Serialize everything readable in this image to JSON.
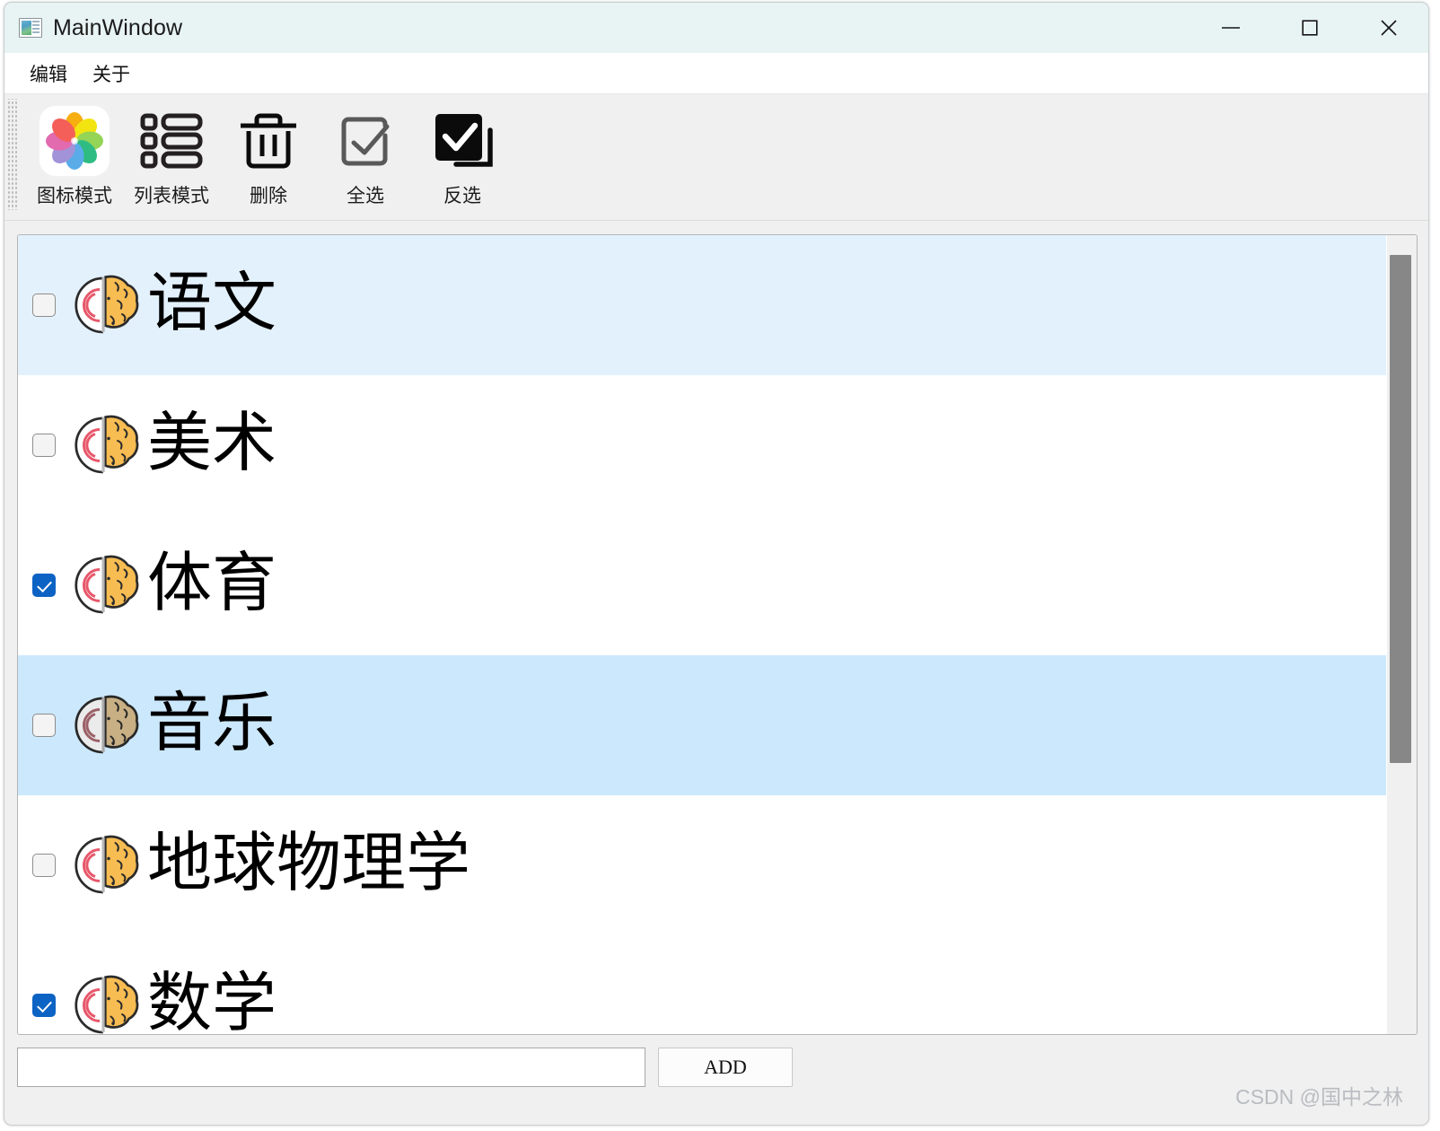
{
  "window": {
    "title": "MainWindow",
    "app_icon": "window-app-icon",
    "controls": {
      "minimize": "minimize-icon",
      "maximize": "maximize-icon",
      "close": "close-icon"
    }
  },
  "menubar": {
    "items": [
      {
        "label": "编辑",
        "name": "menu-edit"
      },
      {
        "label": "关于",
        "name": "menu-about"
      }
    ]
  },
  "toolbar": {
    "buttons": [
      {
        "label": "图标模式",
        "icon": "photos-flower-icon",
        "name": "toolbar-icon-mode"
      },
      {
        "label": "列表模式",
        "icon": "list-icon",
        "name": "toolbar-list-mode"
      },
      {
        "label": "删除",
        "icon": "trash-icon",
        "name": "toolbar-delete"
      },
      {
        "label": "全选",
        "icon": "checkbox-outline-check-icon",
        "name": "toolbar-select-all"
      },
      {
        "label": "反选",
        "icon": "checkbox-filled-check-icon",
        "name": "toolbar-invert-selection"
      }
    ]
  },
  "list": {
    "items": [
      {
        "label": "语文",
        "checked": false,
        "state": "hover"
      },
      {
        "label": "美术",
        "checked": false,
        "state": "normal"
      },
      {
        "label": "体育",
        "checked": true,
        "state": "normal"
      },
      {
        "label": "音乐",
        "checked": false,
        "state": "selected"
      },
      {
        "label": "地球物理学",
        "checked": false,
        "state": "normal"
      },
      {
        "label": "数学",
        "checked": true,
        "state": "normal"
      }
    ],
    "item_icon": "brain-gear-icon",
    "scrollbar": "vertical-scrollbar"
  },
  "bottom": {
    "input_value": "",
    "input_placeholder": "",
    "add_label": "ADD"
  },
  "watermark": {
    "text": "CSDN @国中之林"
  },
  "colors": {
    "titlebar": "#e8f3f3",
    "hover_row": "#e3f1fc",
    "selected_row": "#cce8fc",
    "checkbox_checked": "#0d63c4",
    "window_bg": "#f0f0f0",
    "watermark": "#b9bcc0"
  }
}
